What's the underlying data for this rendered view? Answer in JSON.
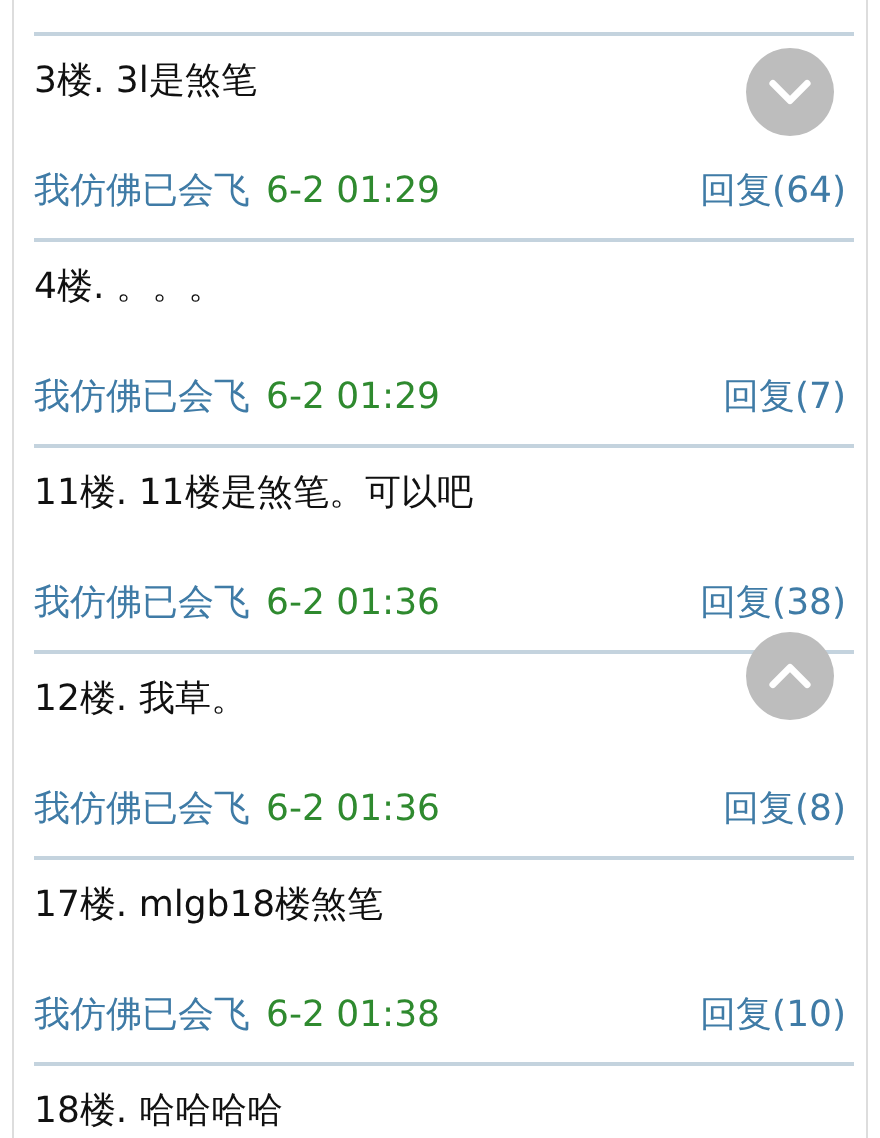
{
  "posts": [
    {
      "content": "3楼. 3l是煞笔",
      "author": "我仿佛已会飞",
      "time": "6-2 01:29",
      "reply": "回复(64)"
    },
    {
      "content": "4楼. 。。。",
      "author": "我仿佛已会飞",
      "time": "6-2 01:29",
      "reply": "回复(7)"
    },
    {
      "content": "11楼. 11楼是煞笔。可以吧",
      "author": "我仿佛已会飞",
      "time": "6-2 01:36",
      "reply": "回复(38)"
    },
    {
      "content": "12楼. 我草。",
      "author": "我仿佛已会飞",
      "time": "6-2 01:36",
      "reply": "回复(8)"
    },
    {
      "content": "17楼. mlgb18楼煞笔",
      "author": "我仿佛已会飞",
      "time": "6-2 01:38",
      "reply": "回复(10)"
    },
    {
      "content": "18楼. 哈哈哈哈"
    }
  ],
  "scroll_buttons": [
    {
      "kind": "down"
    },
    {
      "kind": "up"
    }
  ]
}
